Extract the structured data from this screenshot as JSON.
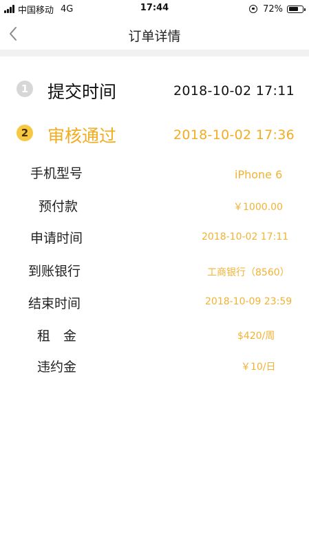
{
  "status_bar": {
    "carrier": "中国移动",
    "network": "4G",
    "time": "17:44",
    "battery": "72%",
    "battery_level": 0.72,
    "icons": [
      "signal-icon",
      "rotation-lock-icon",
      "battery-icon"
    ]
  },
  "nav": {
    "title": "订单详情",
    "back_icon": "chevron-left-icon"
  },
  "steps": [
    {
      "badge": "1",
      "title": "提交时间",
      "time": "2018-10-02  17:11",
      "state": "done"
    },
    {
      "badge": "2",
      "title": "审核通过",
      "time": "2018-10-02  17:36",
      "state": "current"
    }
  ],
  "details": [
    {
      "label": "手机型号",
      "value": "iPhone 6"
    },
    {
      "label": "预付款",
      "value": "￥1000.00"
    },
    {
      "label": "申请时间",
      "value": "2018-10-02 17:11"
    },
    {
      "label": "到账银行",
      "value": "工商银行（8560）"
    },
    {
      "label": "结束时间",
      "value": "2018-10-09 23:59"
    },
    {
      "label": "租　金",
      "value": "$420/周"
    },
    {
      "label": "违约金",
      "value": "￥10/日"
    }
  ],
  "colors": {
    "accent": "#f2ac1f",
    "value_text": "#f2b233",
    "step_done_badge": "#d7d7d7",
    "step_current_badge": "#f7c842",
    "separator": "#f1f1f1"
  }
}
